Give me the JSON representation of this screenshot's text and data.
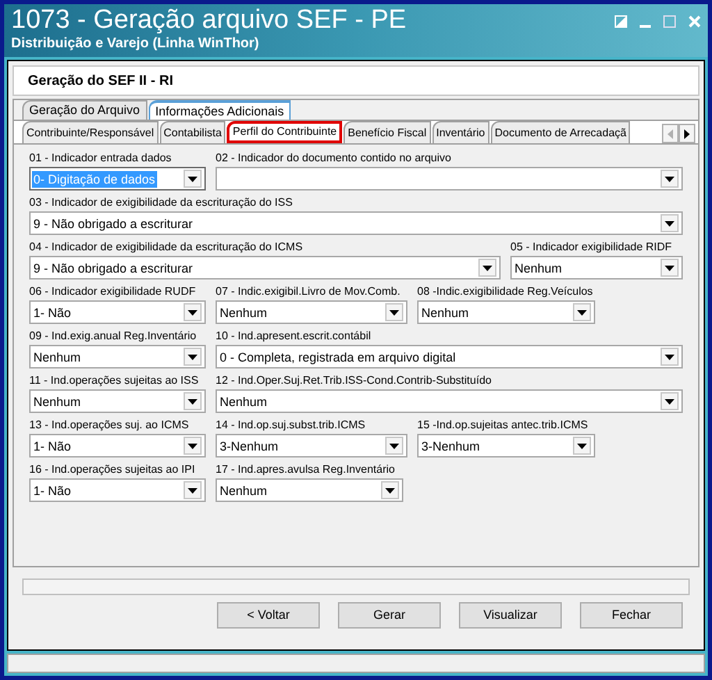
{
  "window": {
    "title": "1073 - Geração arquivo SEF - PE",
    "subtitle": "Distribuição e Varejo (Linha WinThor)"
  },
  "header": {
    "title": "Geração do SEF II - RI"
  },
  "tabs": [
    {
      "label": "Geração do Arquivo",
      "selected": false
    },
    {
      "label": "Informações Adicionais",
      "selected": true
    }
  ],
  "subtabs": [
    {
      "label": "Contribuinte/Responsável",
      "selected": false,
      "highlighted": false
    },
    {
      "label": "Contabilista",
      "selected": false,
      "highlighted": false
    },
    {
      "label": "Perfil do Contribuinte",
      "selected": true,
      "highlighted": true
    },
    {
      "label": "Benefício Fiscal",
      "selected": false,
      "highlighted": false
    },
    {
      "label": "Inventário",
      "selected": false,
      "highlighted": false
    },
    {
      "label": "Documento de Arrecadaçã",
      "selected": false,
      "highlighted": false
    }
  ],
  "form_rows": [
    [
      {
        "label": "01 - Indicador entrada dados",
        "value": "0- Digitação de dados",
        "focused": true
      },
      {
        "label": "02 - Indicador do documento contido no arquivo",
        "focused": false
      }
    ],
    [
      {
        "label": "03 - Indicador de exigibilidade da escrituração do ISS",
        "value": "9 - Não obrigado a escriturar",
        "focused": false
      }
    ],
    [
      {
        "label": "04 - Indicador de exigibilidade da escrituração do ICMS",
        "value": "9 - Não obrigado a escriturar",
        "focused": false
      },
      {
        "label": "05 - Indicador exigibilidade RIDF",
        "value": "Nenhum",
        "focused": false
      }
    ],
    [
      {
        "label": "06 - Indicador exigibilidade RUDF",
        "value": "1- Não",
        "focused": false
      },
      {
        "label": "07 - Indic.exigibil.Livro de Mov.Comb.",
        "value": "Nenhum",
        "focused": false
      },
      {
        "label": "08 -Indic.exigibilidade Reg.Veículos",
        "value": "Nenhum",
        "focused": false
      }
    ],
    [
      {
        "label": "09 - Ind.exig.anual Reg.Inventário",
        "value": "Nenhum",
        "focused": false
      },
      {
        "label": "10 - Ind.apresent.escrit.contábil",
        "value": "0 - Completa, registrada em arquivo digital",
        "focused": false
      }
    ],
    [
      {
        "label": "11 - Ind.operações sujeitas ao ISS",
        "value": "Nenhum",
        "focused": false
      },
      {
        "label": "12 - Ind.Oper.Suj.Ret.Trib.ISS-Cond.Contrib-Substituído",
        "value": "Nenhum",
        "focused": false
      }
    ],
    [
      {
        "label": "13 - Ind.operações suj. ao ICMS",
        "value": "1- Não",
        "focused": false
      },
      {
        "label": "14 - Ind.op.suj.subst.trib.ICMS",
        "value": "3-Nenhum",
        "focused": false
      },
      {
        "label": "15 -Ind.op.sujeitas antec.trib.ICMS",
        "value": "3-Nenhum",
        "focused": false
      }
    ],
    [
      {
        "label": "16 - Ind.operações sujeitas ao IPI",
        "value": "1- Não",
        "focused": false
      },
      {
        "label": "17 - Ind.apres.avulsa Reg.Inventário",
        "value": "Nenhum",
        "focused": false
      }
    ]
  ],
  "progress": {
    "level": 0
  },
  "buttons": [
    "< Voltar",
    "Gerar",
    "Visualizar",
    "Fechar"
  ]
}
